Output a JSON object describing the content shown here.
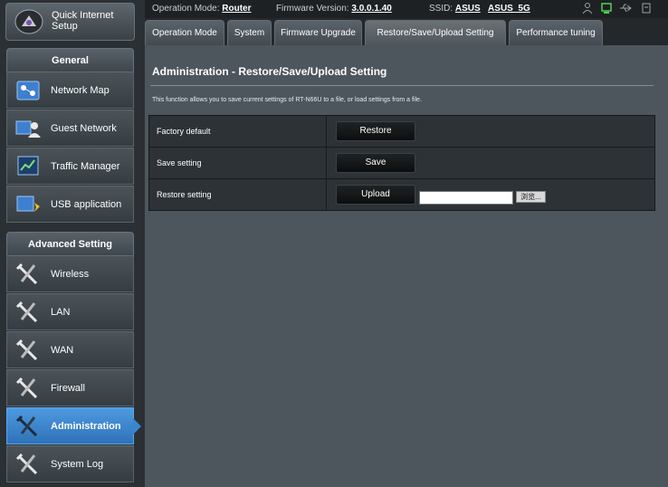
{
  "sidebar": {
    "quick_setup": "Quick Internet Setup",
    "general_header": "General",
    "general_items": [
      {
        "label": "Network Map",
        "icon": "network-map-icon"
      },
      {
        "label": "Guest Network",
        "icon": "guest-network-icon"
      },
      {
        "label": "Traffic Manager",
        "icon": "traffic-manager-icon"
      },
      {
        "label": "USB application",
        "icon": "usb-application-icon"
      }
    ],
    "advanced_header": "Advanced Setting",
    "advanced_items": [
      {
        "label": "Wireless",
        "icon": "tools-icon"
      },
      {
        "label": "LAN",
        "icon": "tools-icon"
      },
      {
        "label": "WAN",
        "icon": "tools-icon"
      },
      {
        "label": "Firewall",
        "icon": "tools-icon"
      },
      {
        "label": "Administration",
        "icon": "tools-icon",
        "active": true
      },
      {
        "label": "System Log",
        "icon": "tools-icon"
      }
    ]
  },
  "topbar": {
    "op_mode_label": "Operation Mode:",
    "op_mode_value": "Router",
    "fw_label": "Firmware Version:",
    "fw_value": "3.0.0.1.40",
    "ssid_label": "SSID:",
    "ssid_1": "ASUS",
    "ssid_2": "ASUS_5G"
  },
  "tabs": [
    "Operation Mode",
    "System",
    "Firmware Upgrade",
    "Restore/Save/Upload Setting",
    "Performance tuning"
  ],
  "main": {
    "title": "Administration - Restore/Save/Upload Setting",
    "description": "This function allows you to save current settings of RT-N66U to a file, or load settings from a file.",
    "rows": [
      {
        "label": "Factory default",
        "button": "Restore"
      },
      {
        "label": "Save setting",
        "button": "Save"
      },
      {
        "label": "Restore setting",
        "button": "Upload"
      }
    ],
    "file_input_value": "",
    "browse_label": "浏览..."
  },
  "colors": {
    "active_nav": "#3a86d0",
    "panel": "#4d565c",
    "sidebar": "#2b3034"
  }
}
